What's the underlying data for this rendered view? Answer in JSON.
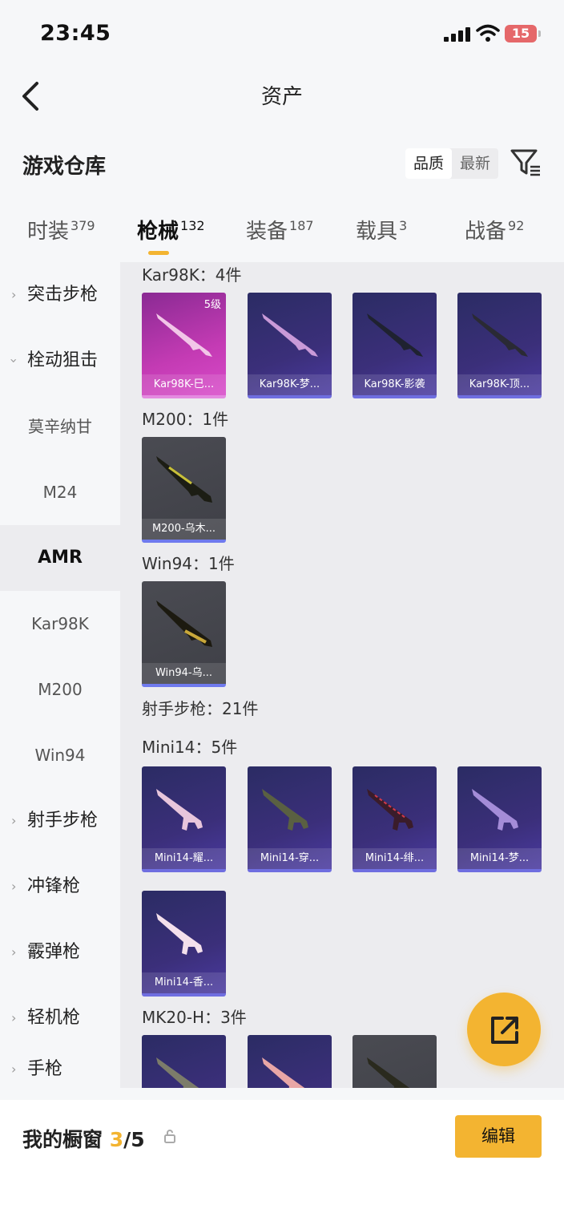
{
  "status_bar": {
    "time": "23:45",
    "battery": "15"
  },
  "header": {
    "title": "资产"
  },
  "section": {
    "title": "游戏仓库",
    "sort_options": [
      "品质",
      "最新"
    ]
  },
  "tabs": [
    {
      "label": "时装",
      "count": "379"
    },
    {
      "label": "枪械",
      "count": "132"
    },
    {
      "label": "装备",
      "count": "187"
    },
    {
      "label": "载具",
      "count": "3"
    },
    {
      "label": "战备",
      "count": "92"
    }
  ],
  "sidebar": {
    "items": [
      {
        "label": "突击步枪"
      },
      {
        "label": "栓动狙击"
      },
      {
        "label": "莫辛纳甘"
      },
      {
        "label": "M24"
      },
      {
        "label": "AMR"
      },
      {
        "label": "Kar98K"
      },
      {
        "label": "M200"
      },
      {
        "label": "Win94"
      },
      {
        "label": "射手步枪"
      },
      {
        "label": "冲锋枪"
      },
      {
        "label": "霰弹枪"
      },
      {
        "label": "轻机枪"
      },
      {
        "label": "手枪"
      }
    ]
  },
  "groups": [
    {
      "title": "Kar98K：4件",
      "items": [
        {
          "name": "Kar98K-巳...",
          "level": "5级"
        },
        {
          "name": "Kar98K-梦..."
        },
        {
          "name": "Kar98K-影袭"
        },
        {
          "name": "Kar98K-顶..."
        }
      ]
    },
    {
      "title": "M200：1件",
      "items": [
        {
          "name": "M200-乌木..."
        }
      ]
    },
    {
      "title": "Win94：1件",
      "items": [
        {
          "name": "Win94-乌..."
        }
      ]
    },
    {
      "title": "射手步枪：21件"
    },
    {
      "title": "Mini14：5件",
      "items": [
        {
          "name": "Mini14-耀..."
        },
        {
          "name": "Mini14-穿..."
        },
        {
          "name": "Mini14-绯..."
        },
        {
          "name": "Mini14-梦..."
        },
        {
          "name": "Mini14-香..."
        }
      ]
    },
    {
      "title": "MK20-H：3件"
    }
  ],
  "showcase": {
    "label": "我的橱窗",
    "used": "3",
    "total": "/5",
    "edit_label": "编辑"
  },
  "colors": {
    "accent": "#f3b431"
  }
}
